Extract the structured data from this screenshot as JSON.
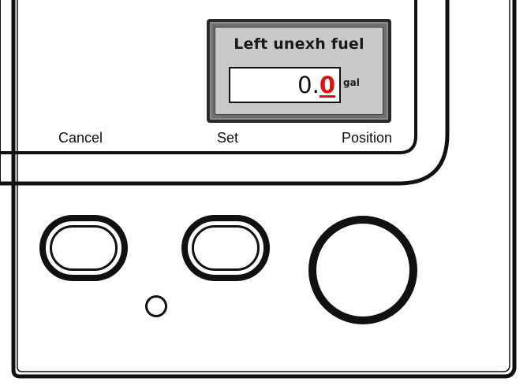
{
  "popup": {
    "title": "Left unexh fuel",
    "value_prefix": "0.",
    "value_active_digit": "0",
    "unit": "gal"
  },
  "softkeys": {
    "cancel_label": "Cancel",
    "set_label": "Set",
    "position_label": "Position"
  },
  "controls": {
    "cancel_button_icon": "oval-button",
    "set_button_icon": "oval-button",
    "position_knob_icon": "round-knob",
    "indicator_icon": "indicator-light"
  },
  "colors": {
    "active_digit": "#e01010",
    "popup_frame": "#6f6f6f",
    "popup_fill": "#c9c9c9",
    "line": "#111111"
  }
}
